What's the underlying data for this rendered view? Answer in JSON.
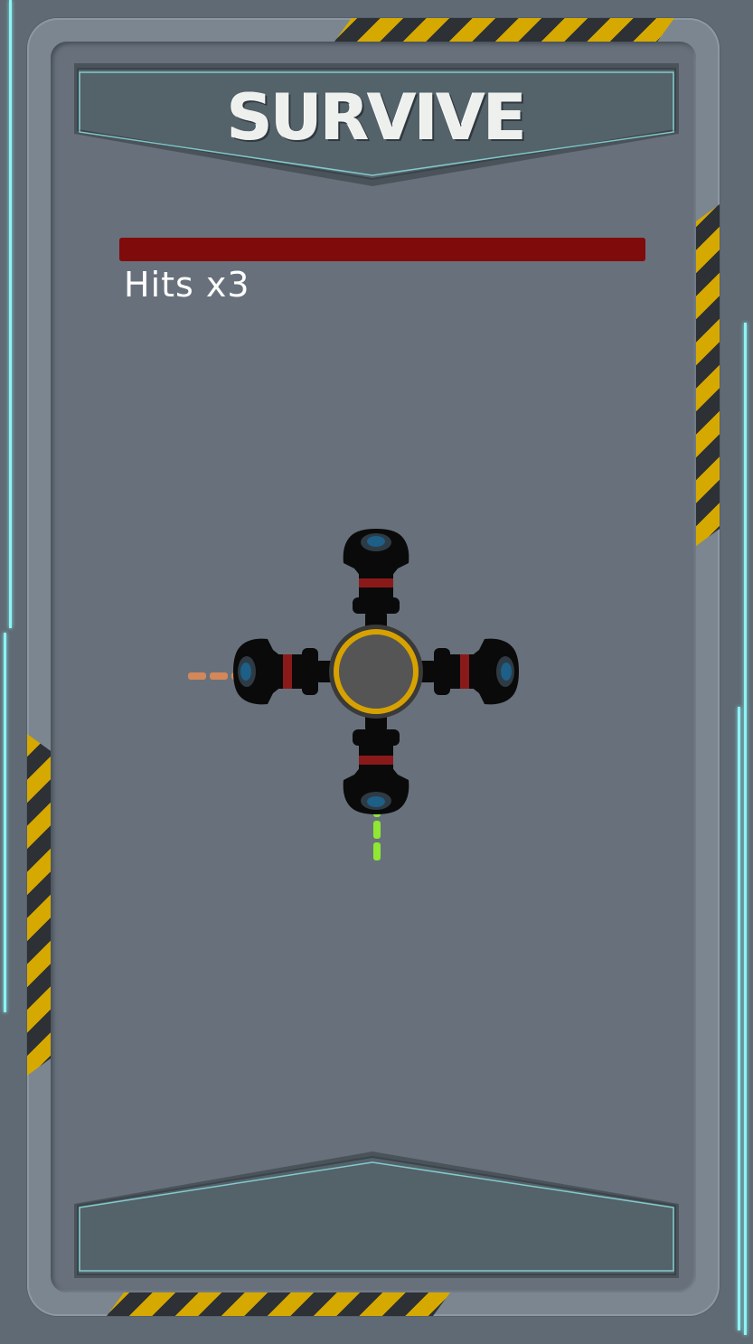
{
  "header": {
    "title": "SURVIVE"
  },
  "hud": {
    "health_fraction": 1.0,
    "hits_label": "Hits x3"
  },
  "turret": {
    "arms": [
      "up",
      "right",
      "down",
      "left"
    ],
    "core_ring_color": "#d7a200",
    "lens_color": "#1d5f87",
    "band_color": "#8a1a1a"
  },
  "projectiles": [
    {
      "name": "player-laser",
      "direction": "down",
      "color": "#8fe832"
    },
    {
      "name": "enemy-laser",
      "direction": "left",
      "color": "#e08a55"
    }
  ],
  "colors": {
    "hazard_yellow": "#d6a900",
    "hazard_dark": "#2d3136",
    "neon": "#8ff3f3",
    "panel": "#55626a"
  }
}
